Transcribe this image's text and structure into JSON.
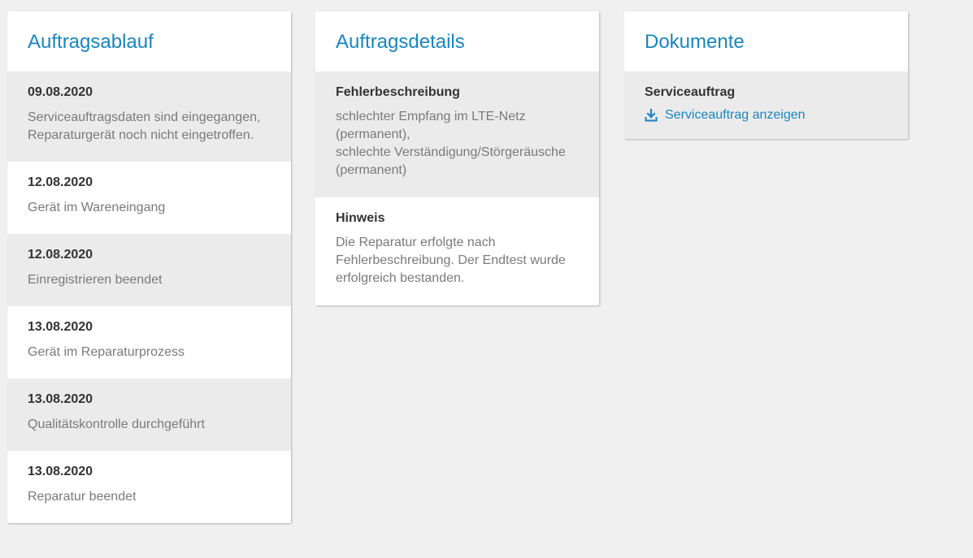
{
  "ablauf": {
    "title": "Auftragsablauf",
    "items": [
      {
        "date": "09.08.2020",
        "lines": [
          "Serviceauftragsdaten sind eingegangen,",
          "Reparaturgerät noch nicht eingetroffen."
        ]
      },
      {
        "date": "12.08.2020",
        "lines": [
          "Gerät im Wareneingang"
        ]
      },
      {
        "date": "12.08.2020",
        "lines": [
          "Einregistrieren beendet"
        ]
      },
      {
        "date": "13.08.2020",
        "lines": [
          "Gerät im Reparaturprozess"
        ]
      },
      {
        "date": "13.08.2020",
        "lines": [
          "Qualitätskontrolle durchgeführt"
        ]
      },
      {
        "date": "13.08.2020",
        "lines": [
          "Reparatur beendet"
        ]
      }
    ]
  },
  "details": {
    "title": "Auftragsdetails",
    "fehler": {
      "heading": "Fehlerbeschreibung",
      "lines": [
        "schlechter Empfang im LTE-Netz",
        "(permanent),",
        "schlechte Verständigung/Störgeräusche",
        "(permanent)"
      ]
    },
    "hinweis": {
      "heading": "Hinweis",
      "lines": [
        "Die Reparatur erfolgte nach",
        "Fehlerbeschreibung. Der Endtest wurde",
        "erfolgreich bestanden."
      ]
    }
  },
  "dokumente": {
    "title": "Dokumente",
    "heading": "Serviceauftrag",
    "link_label": "Serviceauftrag anzeigen",
    "link_icon": "download-icon"
  },
  "colors": {
    "accent": "#1a85c0",
    "background": "#f0f0f0",
    "row_grey": "#ebebeb"
  }
}
